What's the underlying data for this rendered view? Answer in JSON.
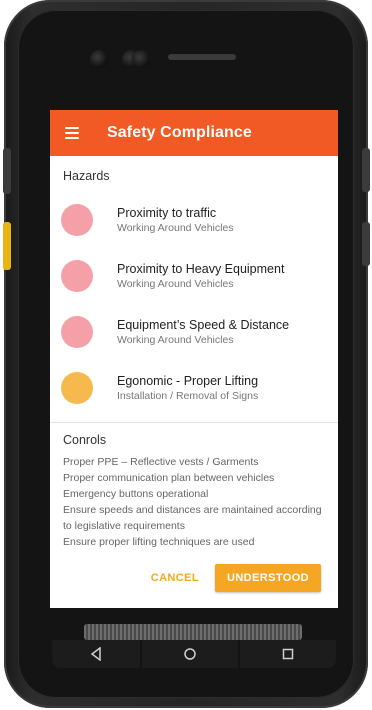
{
  "app": {
    "title": "Safety Compliance",
    "menu_icon": "hamburger-menu-icon"
  },
  "hazards": {
    "title": "Hazards",
    "items": [
      {
        "name": "Proximity to traffic",
        "activity": "Working Around Vehicles",
        "color": "#f5a0a8"
      },
      {
        "name": "Proximity to Heavy Equipment",
        "activity": "Working Around Vehicles",
        "color": "#f5a0a8"
      },
      {
        "name": "Equipment’s Speed & Distance",
        "activity": "Working Around Vehicles",
        "color": "#f5a0a8"
      },
      {
        "name": "Egonomic - Proper Lifting",
        "activity": "Installation / Removal of Signs",
        "color": "#f6b94d"
      }
    ]
  },
  "controls": {
    "title": "Conrols",
    "lines": [
      "Proper PPE – Reflective vests / Garments",
      "Proper communication plan between vehicles",
      "Emergency buttons operational",
      "Ensure speeds and distances are maintained according",
      "to legislative requirements",
      "Ensure proper lifting techniques are used"
    ]
  },
  "actions": {
    "cancel": "CANCEL",
    "confirm": "UNDERSTOOD"
  },
  "colors": {
    "appbar": "#f15a24",
    "accent": "#f5a623"
  },
  "device": {
    "nav_icons": [
      "back-icon",
      "home-icon",
      "recents-icon"
    ]
  }
}
